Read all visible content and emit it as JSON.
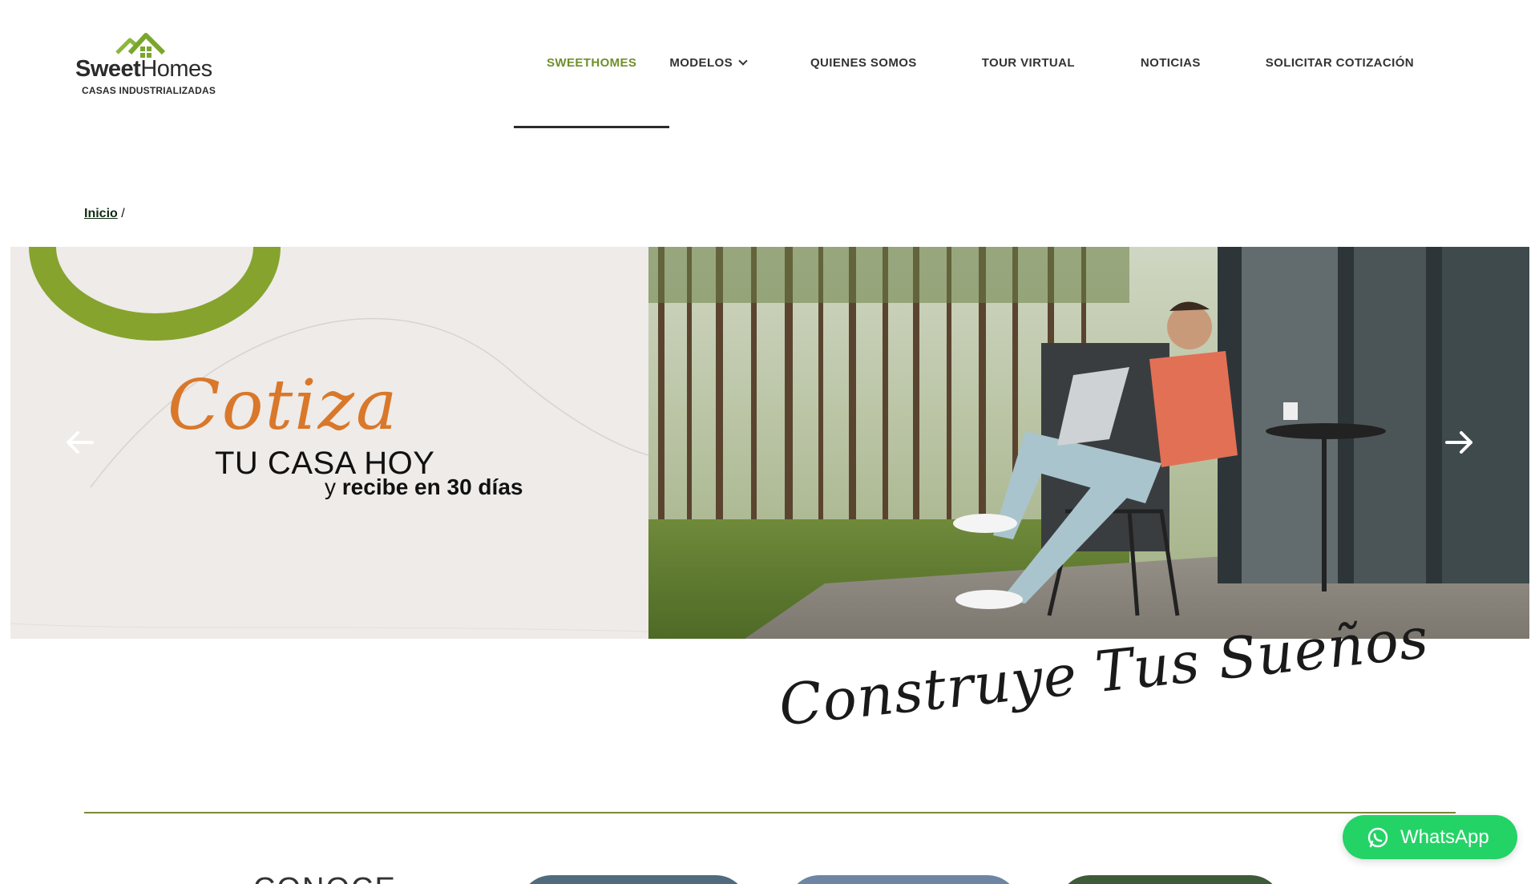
{
  "brand": {
    "name_bold": "Sweet",
    "name_light": "Homes",
    "tagline": "CASAS INDUSTRIALIZADAS",
    "colors": {
      "green": "#6f8f2a",
      "orange": "#d9782a",
      "whatsapp": "#23d366"
    }
  },
  "nav": {
    "items": [
      {
        "label": "SWEETHOMES",
        "active": true
      },
      {
        "label": "MODELOS",
        "has_dropdown": true,
        "icon": "chevron-down-icon"
      },
      {
        "label": "QUIENES SOMOS"
      },
      {
        "label": "TOUR VIRTUAL"
      },
      {
        "label": "NOTICIAS"
      },
      {
        "label": "SOLICITAR COTIZACIÓN"
      }
    ]
  },
  "breadcrumb": {
    "home": "Inicio",
    "separator": "/"
  },
  "hero": {
    "headline_script": "Cotiza",
    "headline_main": "TU CASA HOY",
    "sub_prefix": "y",
    "sub_bold": "recibe en 30 días",
    "prev_icon": "arrow-left-icon",
    "next_icon": "arrow-right-icon"
  },
  "section": {
    "script_title": "Construye Tus Sueños",
    "conoce_title": "CONOCE"
  },
  "whatsapp": {
    "label": "WhatsApp",
    "icon": "whatsapp-icon"
  }
}
